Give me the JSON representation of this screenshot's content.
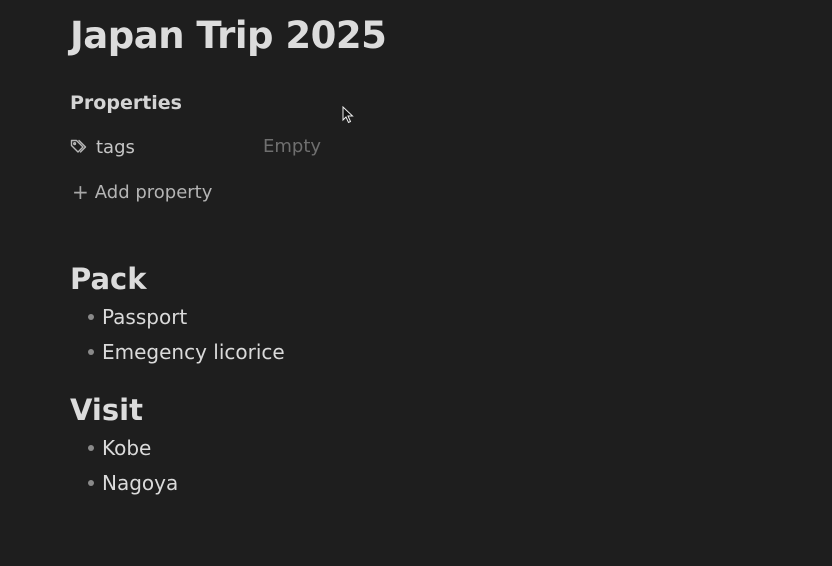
{
  "note": {
    "title": "Japan Trip 2025"
  },
  "properties": {
    "heading": "Properties",
    "items": [
      {
        "key": "tags",
        "icon": "tag-icon",
        "value": "Empty"
      }
    ],
    "add_label": "Add property"
  },
  "sections": [
    {
      "heading": "Pack",
      "items": [
        "Passport",
        "Emegency licorice"
      ]
    },
    {
      "heading": "Visit",
      "items": [
        "Kobe",
        "Nagoya"
      ]
    }
  ],
  "colors": {
    "background": "#1e1e1e",
    "text": "#dadada",
    "muted": "#6f6f6f",
    "bullet": "#8a8a8a"
  }
}
